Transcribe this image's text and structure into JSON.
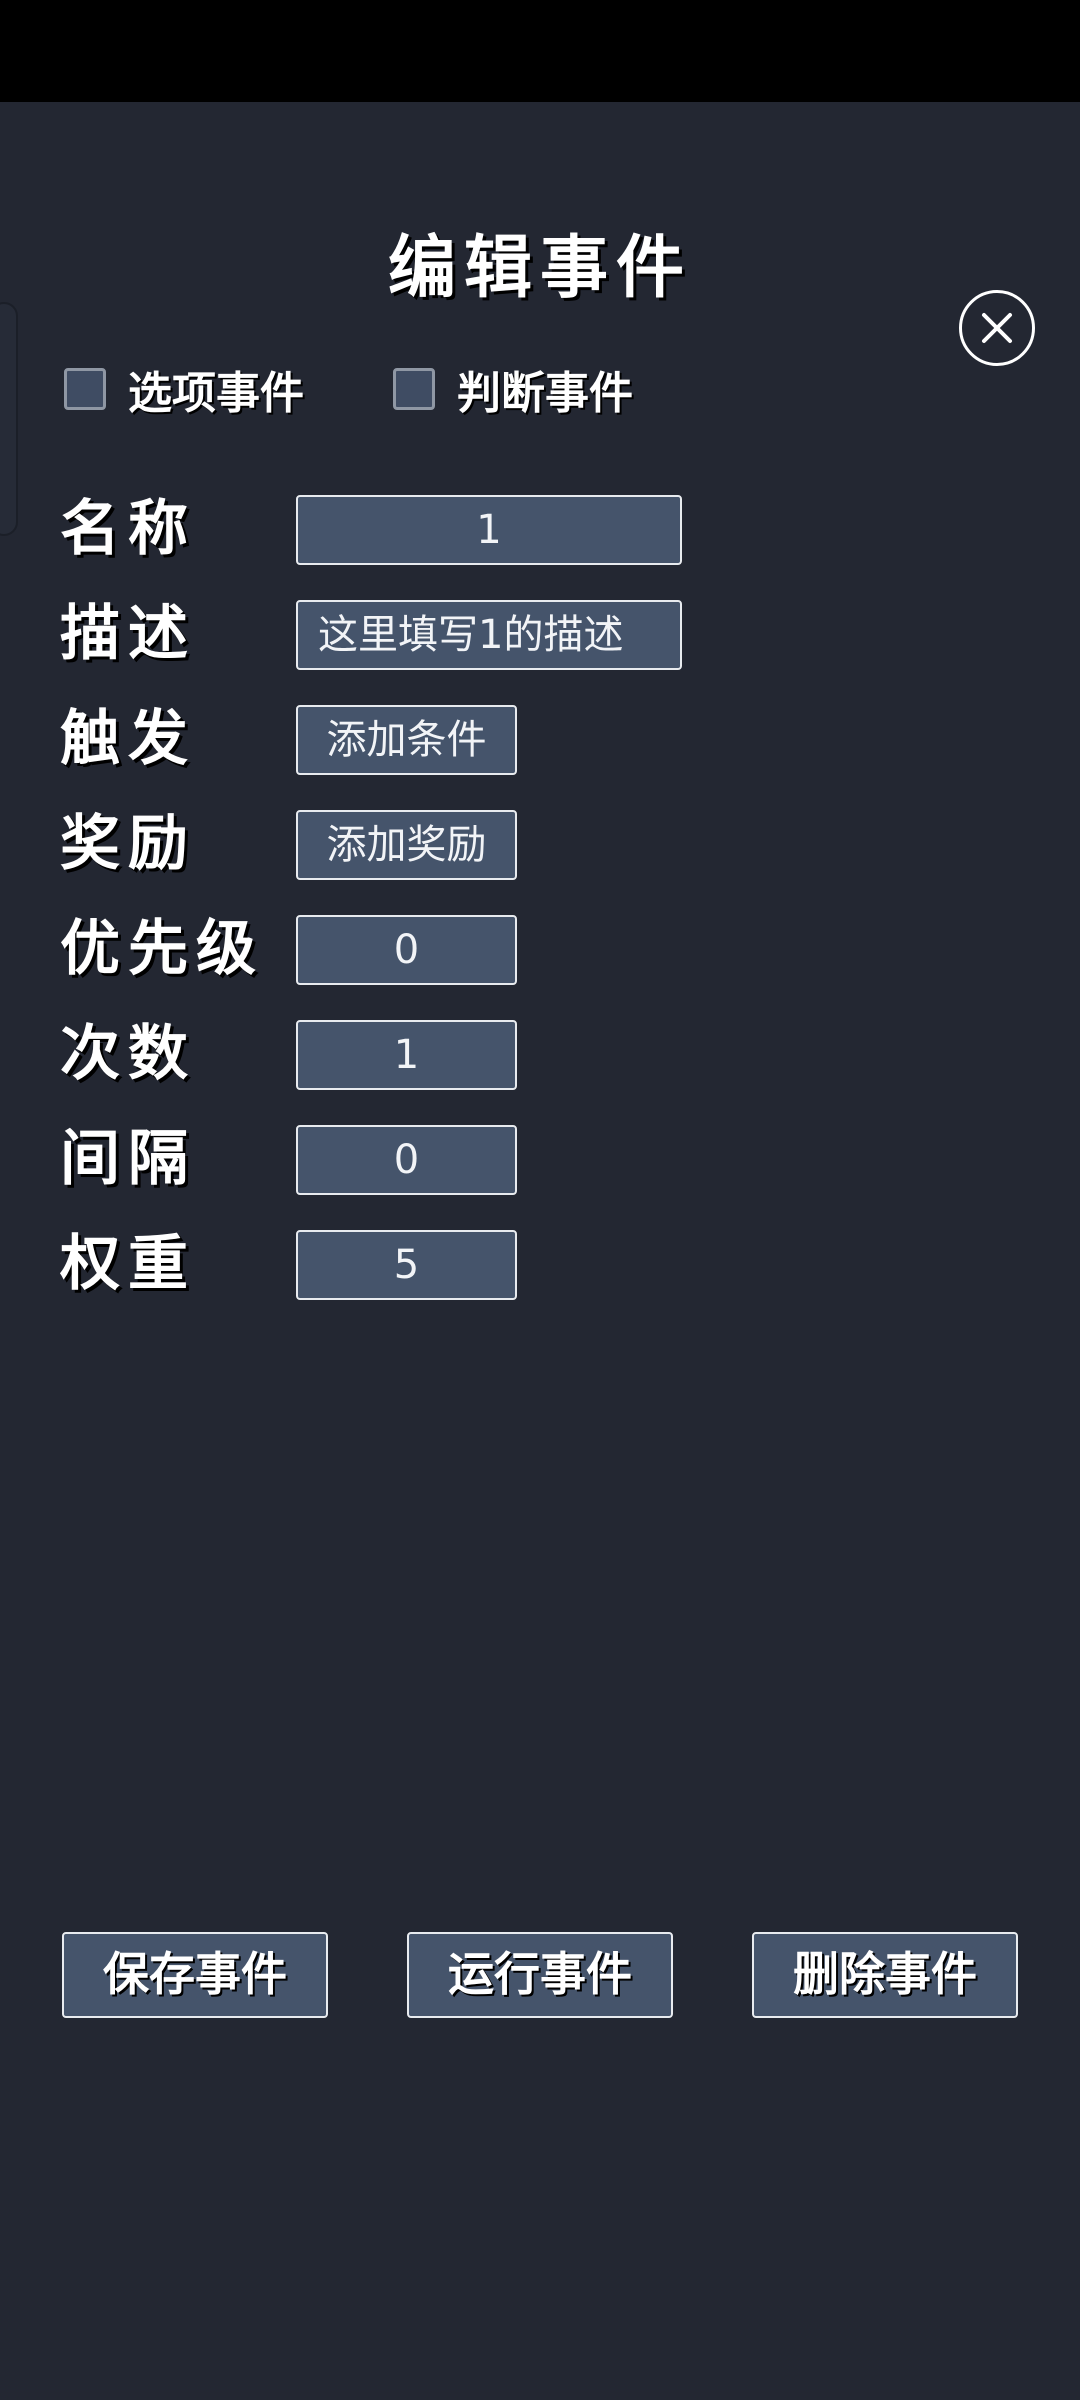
{
  "dialog": {
    "title": "编辑事件",
    "close_icon": "close-icon"
  },
  "options": {
    "choice_event_label": "选项事件",
    "choice_event_checked": false,
    "judge_event_label": "判断事件",
    "judge_event_checked": false
  },
  "fields": {
    "name": {
      "label": "名称",
      "value": "1"
    },
    "description": {
      "label": "描述",
      "value": "这里填写1的描述"
    },
    "trigger": {
      "label": "触发",
      "button": "添加条件"
    },
    "reward": {
      "label": "奖励",
      "button": "添加奖励"
    },
    "priority": {
      "label": "优先级",
      "value": "0"
    },
    "count": {
      "label": "次数",
      "value": "1"
    },
    "interval": {
      "label": "间隔",
      "value": "0"
    },
    "weight": {
      "label": "权重",
      "value": "5"
    }
  },
  "actions": {
    "save_label": "保存事件",
    "run_label": "运行事件",
    "delete_label": "删除事件"
  },
  "colors": {
    "background": "#232732",
    "field_fill": "#45546b",
    "field_border": "#e8ebef",
    "status_bar": "#000000"
  }
}
